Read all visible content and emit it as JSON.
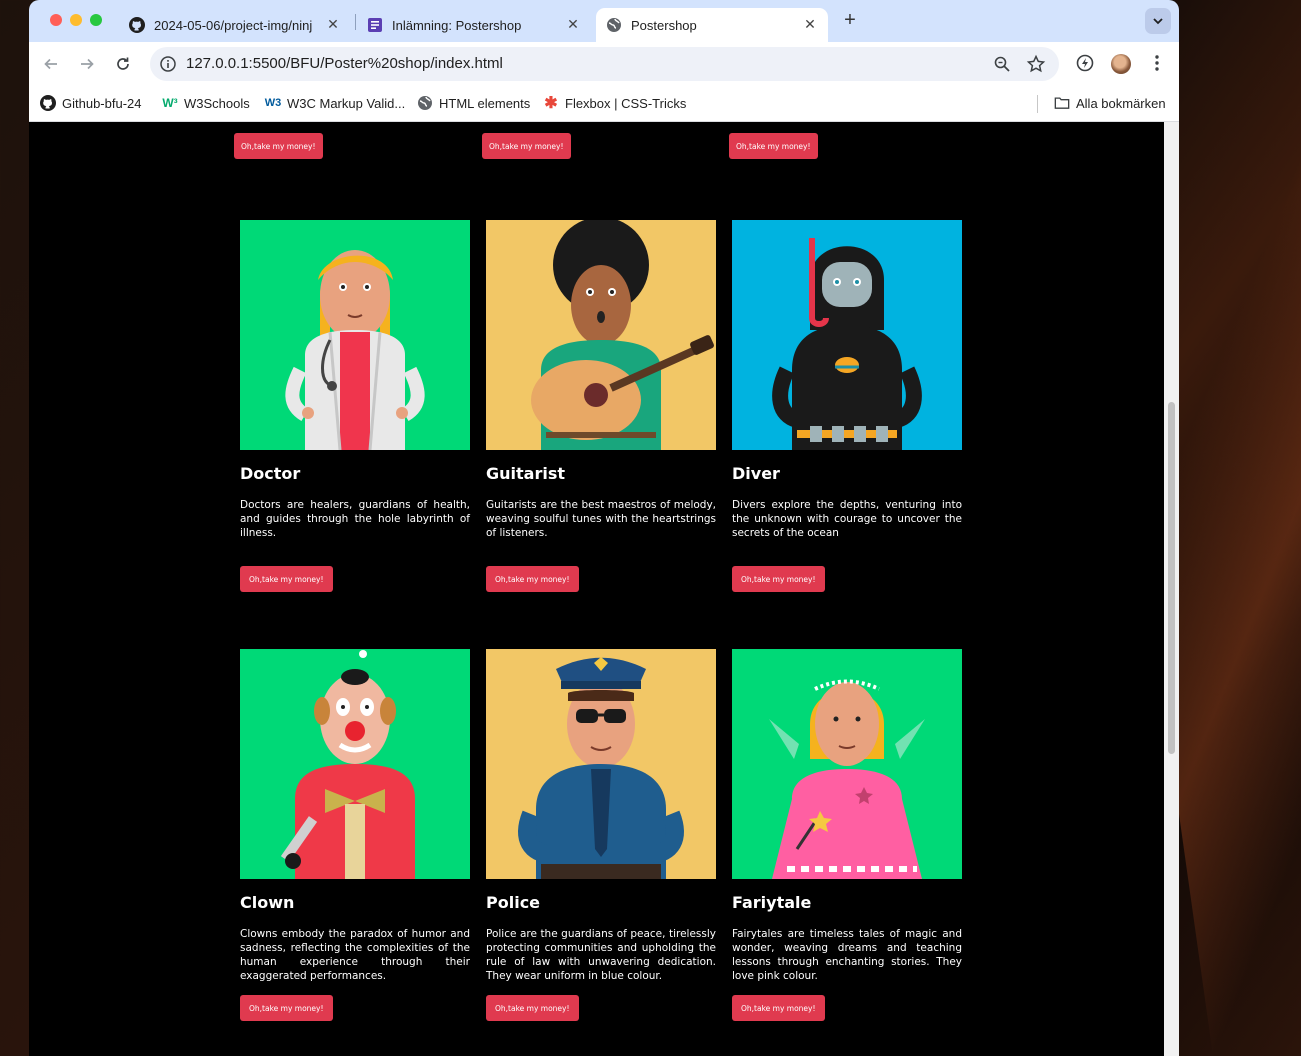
{
  "browser": {
    "tabs": [
      {
        "title": "2024-05-06/project-img/ninj",
        "icon": "github-icon",
        "active": false
      },
      {
        "title": "Inlämning: Postershop",
        "icon": "classroom-icon",
        "active": false
      },
      {
        "title": "Postershop",
        "icon": "globe-icon",
        "active": true
      }
    ],
    "new_tab": "+",
    "url": "127.0.0.1:5500/BFU/Poster%20shop/index.html",
    "bookmarks": [
      {
        "label": "Github-bfu-24",
        "icon": "github-icon"
      },
      {
        "label": "W3Schools",
        "icon": "w3schools-icon"
      },
      {
        "label": "W3C Markup Valid...",
        "icon": "w3c-icon"
      },
      {
        "label": "HTML elements",
        "icon": "globe-icon"
      },
      {
        "label": "Flexbox | CSS-Tricks",
        "icon": "star-asterisk-icon"
      }
    ],
    "all_bookmarks": "Alla bokmärken"
  },
  "page": {
    "buy_label": "Oh,take my money!",
    "products": [
      {
        "name": "Doctor",
        "description": "Doctors are healers, guardians of health, and guides through the hole labyrinth of illness.",
        "bg": "#00d977"
      },
      {
        "name": "Guitarist",
        "description": "Guitarists are the best maestros of melody, weaving soulful tunes with the heartstrings of listeners.",
        "bg": "#f2c766"
      },
      {
        "name": "Diver",
        "description": "Divers explore the depths, venturing into the unknown with courage to uncover the secrets of the ocean",
        "bg": "#00b3e0"
      },
      {
        "name": "Clown",
        "description": "Clowns embody the paradox of humor and sadness, reflecting the complexities of the human experience through their exaggerated performances.",
        "bg": "#00d977"
      },
      {
        "name": "Police",
        "description": "Police are the guardians of peace, tirelessly protecting communities and upholding the rule of law with unwavering dedication. They wear uniform in blue colour.",
        "bg": "#f2c766"
      },
      {
        "name": "Fariytale",
        "description": "Fairytales are timeless tales of magic and wonder, weaving dreams and teaching lessons through enchanting stories. They love pink colour.",
        "bg": "#00d977"
      }
    ]
  },
  "colors": {
    "button": "#e03a4f",
    "page_bg": "#000000",
    "tabstrip": "#d3e3fd"
  }
}
